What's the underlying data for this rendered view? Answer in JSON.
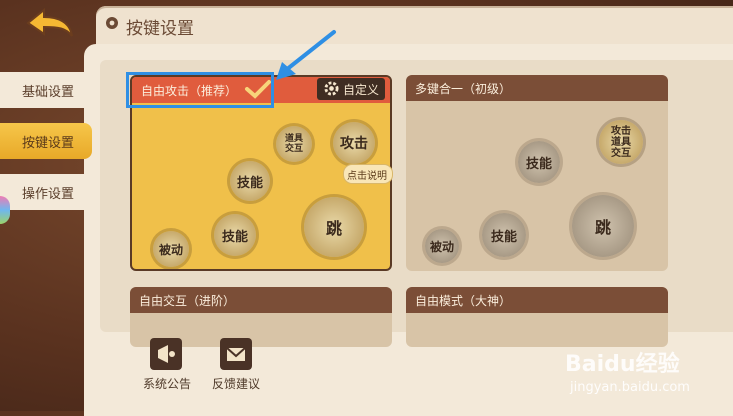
{
  "header": {
    "title": "按键设置"
  },
  "sidebar": {
    "items": [
      {
        "label": "基础设置"
      },
      {
        "label": "按键设置"
      },
      {
        "label": "操作设置"
      }
    ]
  },
  "cards": {
    "free_attack": {
      "title": "自由攻击（推荐）",
      "custom_label": "自定义",
      "explain_label": "点击说明",
      "buttons": {
        "item_interact": "道具交互",
        "attack": "攻击",
        "skill_top": "技能",
        "passive": "被动",
        "skill_bottom": "技能",
        "jump": "跳"
      }
    },
    "multi_key": {
      "title": "多键合一（初级）",
      "buttons": {
        "attack_item_interact": "攻击道具交互",
        "skill_top": "技能",
        "passive": "被动",
        "skill_bottom": "技能",
        "jump": "跳"
      }
    },
    "free_interact": {
      "title": "自由交互（进阶）"
    },
    "free_mode": {
      "title": "自由模式（大神）"
    }
  },
  "bottom": {
    "announcement": "系统公告",
    "feedback": "反馈建议"
  },
  "watermark": {
    "brand": "Baidu经验",
    "url": "jingyan.baidu.com"
  },
  "colors": {
    "accent_blue": "#2f8fe4",
    "selected_header": "#e05c3d",
    "active_tab": "#f0b83a"
  }
}
